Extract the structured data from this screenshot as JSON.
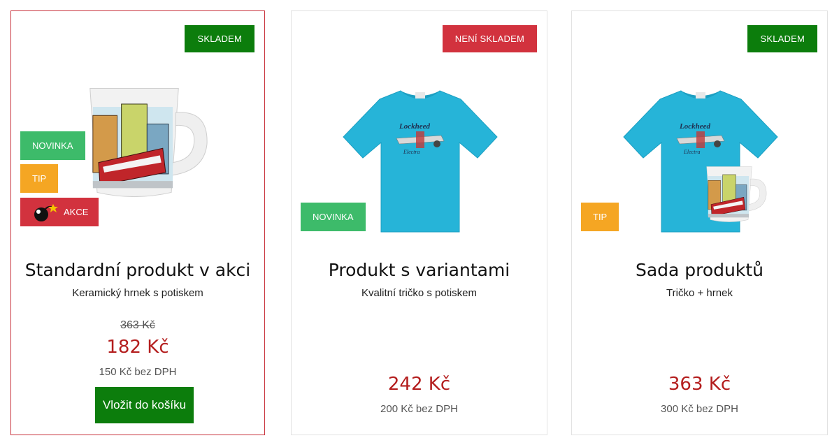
{
  "colors": {
    "in_stock": "#0c7d0c",
    "out_of_stock": "#d2323e",
    "flag_new": "#3dbb6a",
    "flag_tip": "#f5a623",
    "flag_sale": "#d2323e",
    "price": "#b41e1e",
    "cart_button": "#0c7d0c"
  },
  "products": [
    {
      "stock": "SKLADEM",
      "flags": [
        "NOVINKA",
        "TIP",
        "AKCE"
      ],
      "title": "Standardní produkt v akci",
      "subtitle": "Keramický hrnek s potiskem",
      "old_price": "363 Kč",
      "price": "182 Kč",
      "net_price": "150 Kč bez DPH",
      "button": "Vložit do košíku",
      "image_icon": "mug-image"
    },
    {
      "stock": "NENÍ SKLADEM",
      "flags": [
        "NOVINKA"
      ],
      "title": "Produkt s variantami",
      "subtitle": "Kvalitní tričko s potiskem",
      "price": "242 Kč",
      "net_price": "200 Kč bez DPH",
      "image_icon": "tshirt-image"
    },
    {
      "stock": "SKLADEM",
      "flags": [
        "TIP"
      ],
      "title": "Sada produktů",
      "subtitle": "Tričko + hrnek",
      "price": "363 Kč",
      "net_price": "300 Kč bez DPH",
      "image_icon": "tshirt-and-mug-image"
    }
  ]
}
